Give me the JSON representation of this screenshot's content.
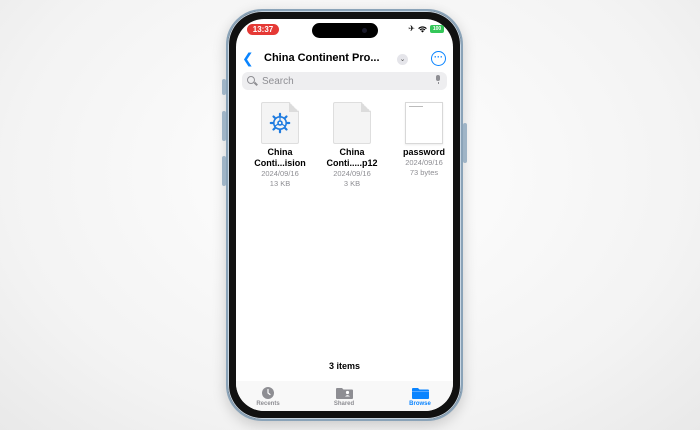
{
  "status_bar": {
    "time": "13:37",
    "battery": "100"
  },
  "nav": {
    "back_icon": "chevron-left-icon",
    "title": "China Continent Pro...",
    "title_menu_icon": "chevron-down-icon",
    "more_icon": "ellipsis-circle-icon"
  },
  "search": {
    "placeholder": "Search",
    "value": "",
    "mic_icon": "mic-icon"
  },
  "files": [
    {
      "name_line1": "China",
      "name_line2": "Conti...ision",
      "date": "2024/09/16",
      "size": "13 KB",
      "icon": "vpn-config-icon"
    },
    {
      "name_line1": "China",
      "name_line2": "Conti.....p12",
      "date": "2024/09/16",
      "size": "3 KB",
      "icon": "blank-document-icon"
    },
    {
      "name_line1": "password",
      "name_line2": "",
      "date": "2024/09/16",
      "size": "73 bytes",
      "icon": "text-document-icon"
    }
  ],
  "footer": {
    "items_count": "3 items"
  },
  "tabbar": {
    "tabs": [
      {
        "label": "Recents",
        "icon": "clock-icon",
        "active": false
      },
      {
        "label": "Shared",
        "icon": "shared-folder-icon",
        "active": false
      },
      {
        "label": "Browse",
        "icon": "folder-icon",
        "active": true
      }
    ]
  },
  "colors": {
    "accent": "#0a84ff",
    "time_pill": "#e53935",
    "battery": "#34c759"
  }
}
